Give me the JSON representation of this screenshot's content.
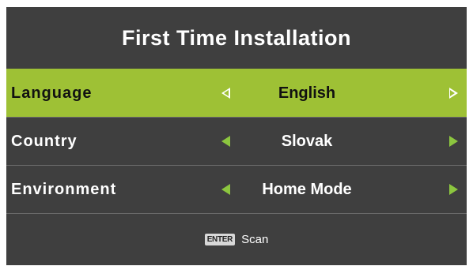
{
  "title": "First Time Installation",
  "rows": [
    {
      "label": "Language",
      "value": "English",
      "selected": true
    },
    {
      "label": "Country",
      "value": "Slovak",
      "selected": false
    },
    {
      "label": "Environment",
      "value": "Home Mode",
      "selected": false
    }
  ],
  "footer": {
    "key_label": "ENTER",
    "action_label": "Scan"
  },
  "icons": {
    "left_arrow": "triangle-left-icon",
    "right_arrow": "triangle-right-icon"
  },
  "colors": {
    "background": "#3f3f3f",
    "highlight": "#9ec135",
    "arrow": "#8cc63f"
  }
}
